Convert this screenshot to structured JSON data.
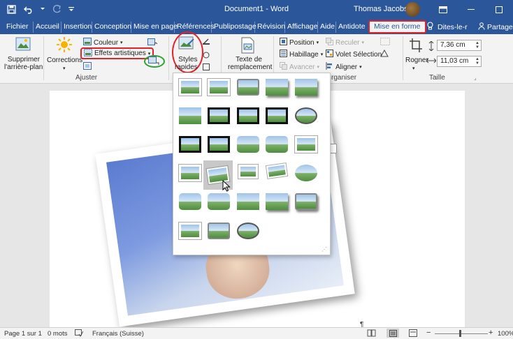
{
  "window": {
    "doc_title": "Document1 - Word",
    "user": "Thomas Jacobsen"
  },
  "menu": {
    "tabs": [
      "Fichier",
      "Accueil",
      "Insertion",
      "Conception",
      "Mise en page",
      "Références",
      "Publipostage",
      "Révision",
      "Affichage",
      "Aide",
      "Antidote",
      "Mise en forme"
    ],
    "active_tab": "Mise en forme",
    "tell_me": "Dites-le-r",
    "share": "Partager"
  },
  "ribbon": {
    "remove_bg": "Supprimer\nl'arrière-plan",
    "remove_bg_line1": "Supprimer",
    "remove_bg_line2": "l'arrière-plan",
    "corrections": "Corrections",
    "couleur": "Couleur",
    "effets": "Effets artistiques",
    "adjust_group": "Ajuster",
    "styles_line1": "Styles",
    "styles_line2": "rapides",
    "alt_text_line1": "Texte de",
    "alt_text_line2": "remplacement",
    "position": "Position",
    "habillage": "Habillage",
    "avancer": "Avancer",
    "reculer": "Reculer",
    "volet": "Volet Sélection",
    "aligner": "Aligner",
    "organiser_group": "rganiser",
    "rogner": "Rogner",
    "height": "7,36 cm",
    "width": "11,03 cm",
    "taille_group": "Taille"
  },
  "status": {
    "page": "Page 1 sur 1",
    "words": "0 mots",
    "language": "Français (Suisse)",
    "zoom": "100%"
  },
  "colors": {
    "word_blue": "#2b579a",
    "highlight_red": "#e0242c",
    "highlight_green": "#2fa336"
  }
}
